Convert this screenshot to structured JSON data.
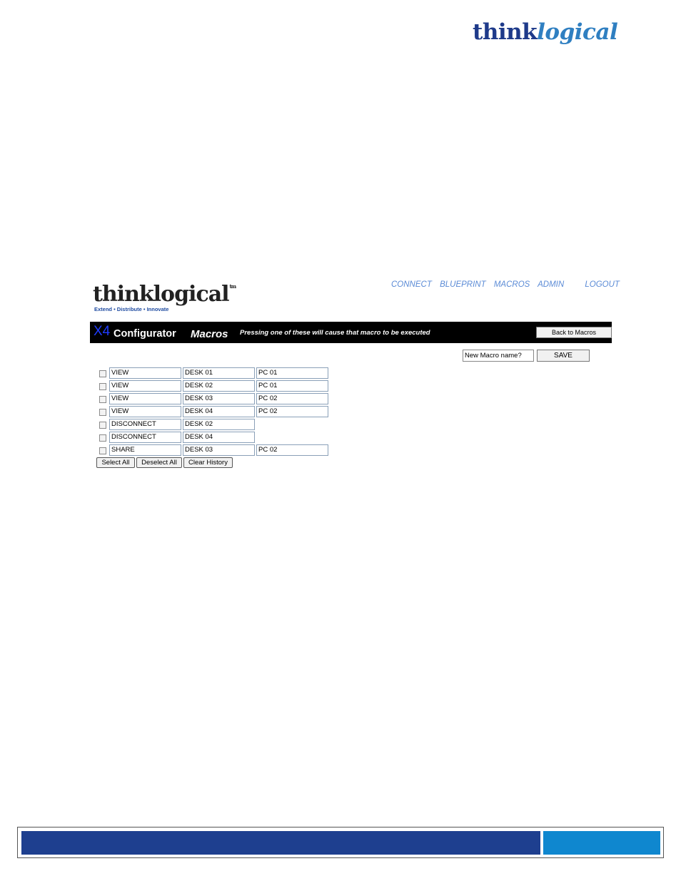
{
  "page": {
    "logo": {
      "think": "think",
      "logical": "logical"
    }
  },
  "app": {
    "nav": [
      "CONNECT",
      "BLUEPRINT",
      "MACROS",
      "ADMIN",
      "LOGOUT"
    ],
    "logo": {
      "word": "thinklogical",
      "tm": "tm",
      "tagline": "Extend • Distribute • Innovate"
    },
    "title_bar": {
      "x4": "X4",
      "configurator": "Configurator",
      "section": "Macros",
      "note": "Pressing one of these will cause that macro to be executed",
      "back_button": "Back to Macros"
    },
    "new_macro": {
      "value": "New Macro name?",
      "save_label": "SAVE"
    },
    "macros": [
      {
        "action": "VIEW",
        "desk": "DESK 01",
        "pc": "PC 01"
      },
      {
        "action": "VIEW",
        "desk": "DESK 02",
        "pc": "PC 01"
      },
      {
        "action": "VIEW",
        "desk": "DESK 03",
        "pc": "PC 02"
      },
      {
        "action": "VIEW",
        "desk": "DESK 04",
        "pc": "PC 02"
      },
      {
        "action": "DISCONNECT",
        "desk": "DESK 02",
        "pc": null
      },
      {
        "action": "DISCONNECT",
        "desk": "DESK 04",
        "pc": null
      },
      {
        "action": "SHARE",
        "desk": "DESK 03",
        "pc": "PC 02"
      }
    ],
    "buttons": {
      "select_all": "Select All",
      "deselect_all": "Deselect All",
      "clear_history": "Clear History"
    }
  },
  "footer": {
    "left_color": "#1e3f8f",
    "right_color": "#0f87cf"
  }
}
